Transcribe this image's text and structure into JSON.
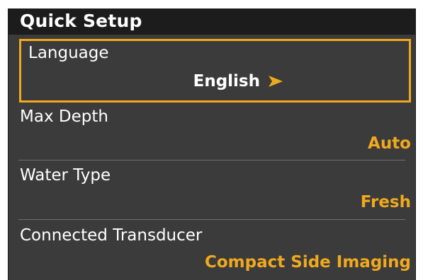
{
  "title": "Quick Setup",
  "items": [
    {
      "label": "Language",
      "value": "English",
      "selected": true
    },
    {
      "label": "Max Depth",
      "value": "Auto",
      "selected": false
    },
    {
      "label": "Water Type",
      "value": "Fresh",
      "selected": false
    },
    {
      "label": "Connected Transducer",
      "value": "Compact Side Imaging",
      "selected": false
    }
  ],
  "icons": {
    "selected_arrow": "chevron-right-icon"
  },
  "colors": {
    "panel_bg": "#3b3b3b",
    "title_bg": "#1c1c1c",
    "accent": "#f0a91f",
    "text": "#ffffff",
    "divider": "#6e6e6e"
  }
}
